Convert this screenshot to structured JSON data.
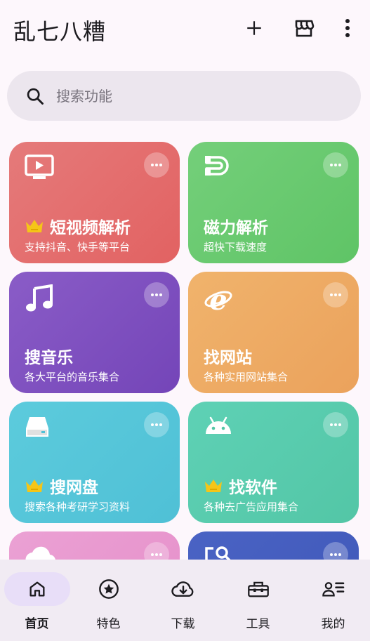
{
  "app": {
    "title": "乱七八糟"
  },
  "toolbar": {
    "icons": [
      "add-icon",
      "store-icon",
      "more-vert-icon"
    ]
  },
  "search": {
    "placeholder": "搜索功能",
    "value": ""
  },
  "cards": [
    {
      "title": "短视频解析",
      "subtitle": "支持抖音、快手等平台",
      "premium": true,
      "icon": "tv-play-icon",
      "gradient": [
        "#e57a7a",
        "#e26262"
      ]
    },
    {
      "title": "磁力解析",
      "subtitle": "超快下载速度",
      "premium": false,
      "icon": "magnet-icon",
      "gradient": [
        "#74cf7a",
        "#5fc466"
      ]
    },
    {
      "title": "搜音乐",
      "subtitle": "各大平台的音乐集合",
      "premium": false,
      "icon": "music-note-icon",
      "gradient": [
        "#8a5cc7",
        "#7445b8"
      ]
    },
    {
      "title": "找网站",
      "subtitle": "各种实用网站集合",
      "premium": false,
      "icon": "browser-e-icon",
      "gradient": [
        "#f0b36c",
        "#eba25c"
      ]
    },
    {
      "title": "搜网盘",
      "subtitle": "搜索各种考研学习资料",
      "premium": true,
      "icon": "drive-icon",
      "gradient": [
        "#5ccbdc",
        "#4fc0d6"
      ]
    },
    {
      "title": "找软件",
      "subtitle": "各种去广告应用集合",
      "premium": true,
      "icon": "android-icon",
      "gradient": [
        "#5ed1b5",
        "#53c6a6"
      ]
    },
    {
      "title": "",
      "subtitle": "",
      "premium": false,
      "icon": "cloud-icon",
      "gradient": [
        "#eba1d4",
        "#e58ec9"
      ]
    },
    {
      "title": "",
      "subtitle": "",
      "premium": false,
      "icon": "image-search-icon",
      "gradient": [
        "#4a63c4",
        "#3f57b8"
      ]
    }
  ],
  "nav": {
    "items": [
      {
        "label": "首页",
        "icon": "home-icon",
        "active": true
      },
      {
        "label": "特色",
        "icon": "star-badge-icon",
        "active": false
      },
      {
        "label": "下载",
        "icon": "cloud-download-icon",
        "active": false
      },
      {
        "label": "工具",
        "icon": "toolbox-icon",
        "active": false
      },
      {
        "label": "我的",
        "icon": "profile-list-icon",
        "active": false
      }
    ]
  },
  "colors": {
    "background": "#fdf7fc",
    "search_bg": "#ece6ee",
    "nav_bg": "#f1ebf3",
    "nav_active_pill": "#e8def8",
    "crown": "#f5c518"
  }
}
